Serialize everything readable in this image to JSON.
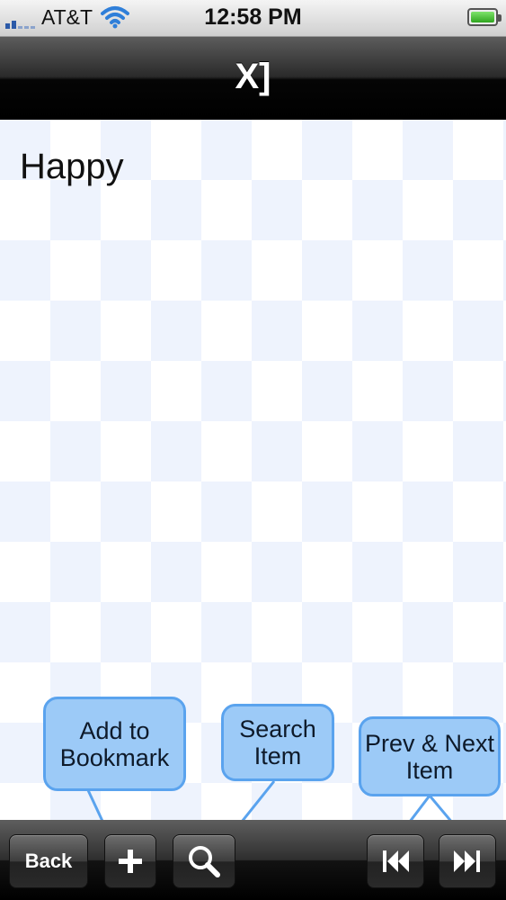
{
  "status_bar": {
    "carrier": "AT&T",
    "time": "12:58 PM"
  },
  "nav": {
    "title": "X]"
  },
  "content": {
    "word": "Happy"
  },
  "callouts": {
    "bookmark": [
      "Add to",
      "Bookmark"
    ],
    "search": [
      "Search",
      "Item"
    ],
    "prev_next": [
      "Prev & Next",
      "Item"
    ]
  },
  "toolbar": {
    "back_label": "Back"
  },
  "icons": [
    "wifi-icon",
    "battery-icon",
    "plus-icon",
    "search-icon",
    "previous-icon",
    "next-icon"
  ],
  "colors": {
    "callout_fill": "#9ccaf7",
    "callout_border": "#5aa3ee",
    "checker": "#eef3fd"
  }
}
